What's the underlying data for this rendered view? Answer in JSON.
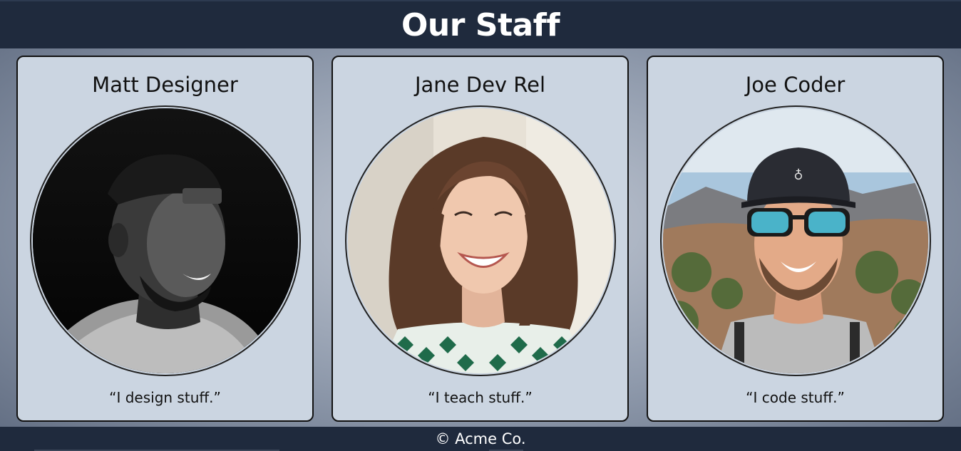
{
  "header": {
    "title": "Our Staff"
  },
  "staff": [
    {
      "name": "Matt Designer",
      "quote": "“I design stuff.”",
      "photo_icon": "portrait-man-cap-bw"
    },
    {
      "name": "Jane Dev Rel",
      "quote": "“I teach stuff.”",
      "photo_icon": "portrait-woman-smiling"
    },
    {
      "name": "Joe Coder",
      "quote": "“I code stuff.”",
      "photo_icon": "portrait-man-sunglasses"
    }
  ],
  "footer": {
    "copyright": "© Acme Co."
  },
  "colors": {
    "bar": "#1f2a3d",
    "card": "#cbd5e1",
    "text": "#111111"
  }
}
